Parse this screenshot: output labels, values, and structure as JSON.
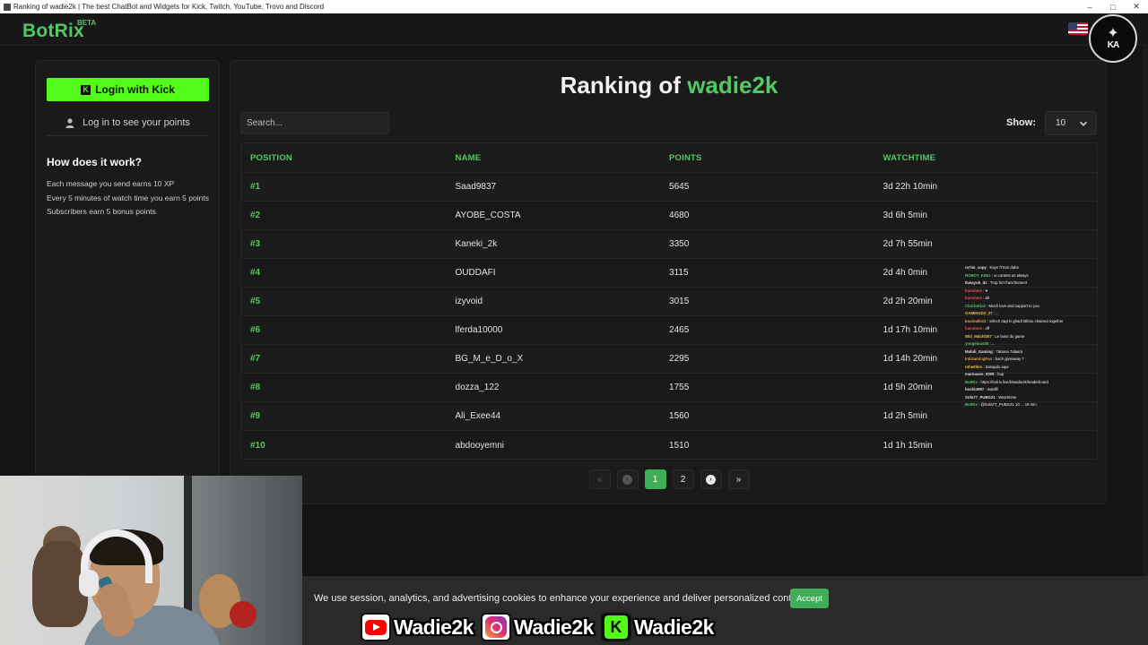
{
  "window": {
    "title": "Ranking of wadie2k | The best ChatBot and Widgets for Kick, Twitch, YouTube, Trovo and Discord",
    "controls": [
      "–",
      "□",
      "✕"
    ]
  },
  "navbar": {
    "logo": "BotRix",
    "logo_badge": "BETA",
    "language_flag": "us-flag-icon",
    "channel_badge_text": "KA"
  },
  "sidebar": {
    "login_kick_label": "Login with Kick",
    "login_points_label": "Log in to see your points",
    "how_title": "How does it work?",
    "how_items": [
      "Each message you send earns 10 XP",
      "Every 5 minutes of watch time you earn 5 points",
      "Subscribers earn 5 bonus points"
    ]
  },
  "main": {
    "title_prefix": "Ranking of",
    "title_channel": "wadie2k",
    "search_placeholder": "Search...",
    "show_label": "Show:",
    "show_value": "10",
    "columns": [
      "POSITION",
      "NAME",
      "POINTS",
      "WATCHTIME"
    ],
    "rows": [
      {
        "position": "#1",
        "name": "Saad9837",
        "points": "5645",
        "watchtime": "3d 22h 10min"
      },
      {
        "position": "#2",
        "name": "AYOBE_COSTA",
        "points": "4680",
        "watchtime": "3d 6h 5min"
      },
      {
        "position": "#3",
        "name": "Kaneki_2k",
        "points": "3350",
        "watchtime": "2d 7h 55min"
      },
      {
        "position": "#4",
        "name": "OUDDAFI",
        "points": "3115",
        "watchtime": "2d 4h 0min"
      },
      {
        "position": "#5",
        "name": "izyvoid",
        "points": "3015",
        "watchtime": "2d 2h 20min"
      },
      {
        "position": "#6",
        "name": "lferda10000",
        "points": "2465",
        "watchtime": "1d 17h 10min"
      },
      {
        "position": "#7",
        "name": "BG_M_e_D_o_X",
        "points": "2295",
        "watchtime": "1d 14h 20min"
      },
      {
        "position": "#8",
        "name": "dozza_122",
        "points": "1755",
        "watchtime": "1d 5h 20min"
      },
      {
        "position": "#9",
        "name": "Ali_Exee44",
        "points": "1560",
        "watchtime": "1d 2h 5min"
      },
      {
        "position": "#10",
        "name": "abdooyemni",
        "points": "1510",
        "watchtime": "1d 1h 15min"
      }
    ],
    "pagination": {
      "first": "«",
      "prev": "‹",
      "pages": [
        "1",
        "2"
      ],
      "current_page": "1",
      "next": "›",
      "last": "»"
    }
  },
  "chat_overlay": [
    {
      "user": "ra7im_copy",
      "user_color": "#e0e0e0",
      "message": ": Kayn l7mar dabe"
    },
    {
      "user": "ROBOT_KING",
      "user_color": "#53c963",
      "message": ": w content as always"
    },
    {
      "user": "Ilasayub_dz",
      "user_color": "#e0e0e0",
      "message": ": Trop fort franchement"
    },
    {
      "user": "hamdane",
      "user_color": "#e05050",
      "message": ": ♥"
    },
    {
      "user": "hamdane",
      "user_color": "#e05050",
      "message": ": ah"
    },
    {
      "user": "CloCloKick",
      "user_color": "#53c963",
      "message": ": Much love and support to you"
    },
    {
      "user": "GAMINGDZ_27",
      "user_color": "#e8c24a",
      "message": ": ..."
    },
    {
      "user": "kouloulkick",
      "user_color": "#e8a04a",
      "message": ": 5rfech dayrin ghadi l3lbou chained together"
    },
    {
      "user": "hamdane",
      "user_color": "#e05050",
      "message": ": off"
    },
    {
      "user": "Wid_Mdahl307",
      "user_color": "#e8c24a",
      "message": ": Le boss du game"
    },
    {
      "user": "yongelous05",
      "user_color": "#53c963",
      "message": ": ..."
    },
    {
      "user": "Mahdi_Gaming",
      "user_color": "#e0e0e0",
      "message": ": 7atama 7alaara"
    },
    {
      "user": "Ir4iGamingFan",
      "user_color": "#e8a04a",
      "message": ": bach giveaway ?"
    },
    {
      "user": "rafaeltkm",
      "user_color": "#e8c24a",
      "message": ": tranquilo aqui"
    },
    {
      "user": "marouane_0009",
      "user_color": "#e0e0e0",
      "message": ": hop"
    },
    {
      "user": "BotRix",
      "user_color": "#53c963",
      "message": ": https://botrix.live/k/wadie2k/leaderboard"
    },
    {
      "user": "hoshin997",
      "user_color": "#e0e0e0",
      "message": ": wa8llll"
    },
    {
      "user": "Sofa77_PUBG21",
      "user_color": "#e0e0e0",
      "message": ": Watchtime"
    },
    {
      "user": "BotRix",
      "user_color": "#53c963",
      "message": ": @Sofa77_PUBG21 10 ... 19 min."
    }
  ],
  "cookie_bar": {
    "text": "We use session, analytics, and advertising cookies to enhance your experience and deliver personalized content.",
    "accept_label": "Accept"
  },
  "socials": [
    {
      "icon": "youtube-icon",
      "handle": "Wadie2k"
    },
    {
      "icon": "instagram-icon",
      "handle": "Wadie2k"
    },
    {
      "icon": "kick-icon",
      "handle": "Wadie2k"
    }
  ],
  "colors": {
    "accent_green": "#53c963",
    "kick_green": "#53fc18",
    "background": "#141414",
    "card": "#1a1a1a"
  }
}
